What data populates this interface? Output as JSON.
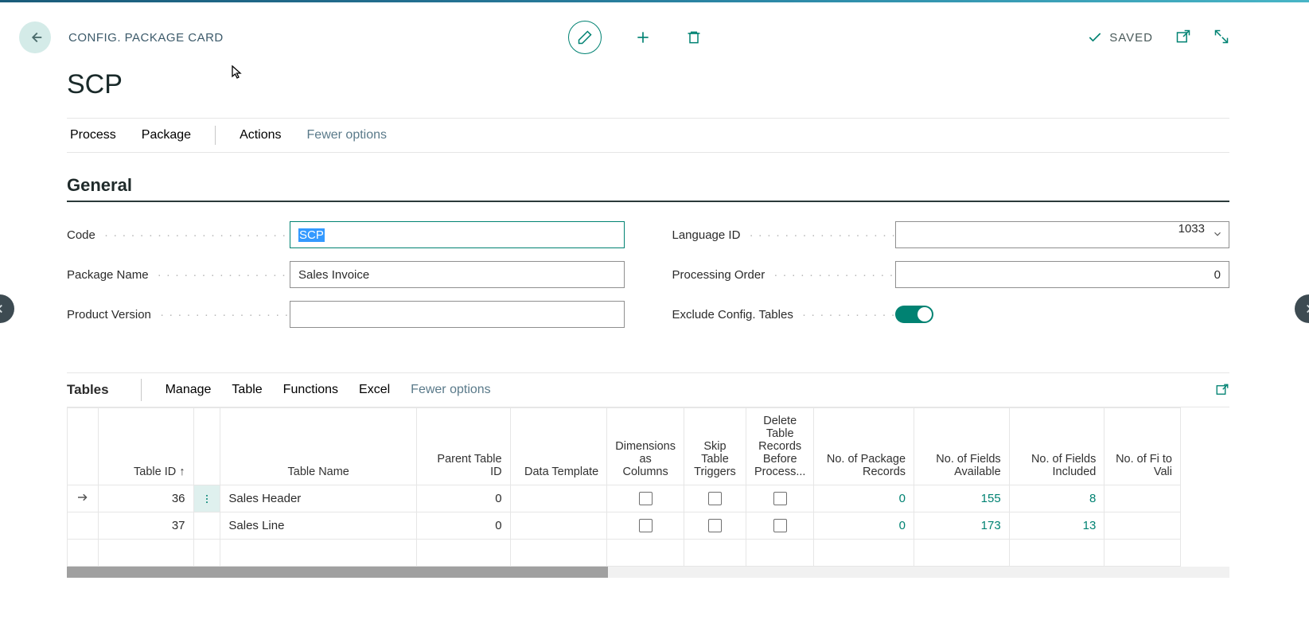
{
  "header": {
    "breadcrumb": "CONFIG. PACKAGE CARD",
    "title": "SCP",
    "saved_label": "SAVED"
  },
  "main_tabs": {
    "process": "Process",
    "package": "Package",
    "actions": "Actions",
    "fewer": "Fewer options"
  },
  "general": {
    "section_title": "General",
    "labels": {
      "code": "Code",
      "package_name": "Package Name",
      "product_version": "Product Version",
      "language_id": "Language ID",
      "processing_order": "Processing Order",
      "exclude_config_tables": "Exclude Config. Tables"
    },
    "values": {
      "code": "SCP",
      "package_name": "Sales Invoice",
      "product_version": "",
      "language_id": "1033",
      "processing_order": "0",
      "exclude_config_tables": true
    }
  },
  "tables_section": {
    "title": "Tables",
    "tabs": {
      "manage": "Manage",
      "table": "Table",
      "functions": "Functions",
      "excel": "Excel",
      "fewer": "Fewer options"
    },
    "columns": {
      "table_id": "Table ID ↑",
      "table_name": "Table Name",
      "parent_table_id": "Parent Table ID",
      "data_template": "Data Template",
      "dimensions_as_columns": "Dimensions as Columns",
      "skip_table_triggers": "Skip Table Triggers",
      "delete_records": "Delete Table Records Before Process...",
      "no_package_records": "No. of Package Records",
      "no_fields_available": "No. of Fields Available",
      "no_fields_included": "No. of Fields Included",
      "no_fields_validate": "No. of Fi to Vali"
    },
    "rows": [
      {
        "table_id": "36",
        "table_name": "Sales Header",
        "parent_table_id": "0",
        "data_template": "",
        "dimensions_as_columns": false,
        "skip_table_triggers": false,
        "delete_records": false,
        "no_package_records": "0",
        "no_fields_available": "155",
        "no_fields_included": "8"
      },
      {
        "table_id": "37",
        "table_name": "Sales Line",
        "parent_table_id": "0",
        "data_template": "",
        "dimensions_as_columns": false,
        "skip_table_triggers": false,
        "delete_records": false,
        "no_package_records": "0",
        "no_fields_available": "173",
        "no_fields_included": "13"
      }
    ]
  }
}
